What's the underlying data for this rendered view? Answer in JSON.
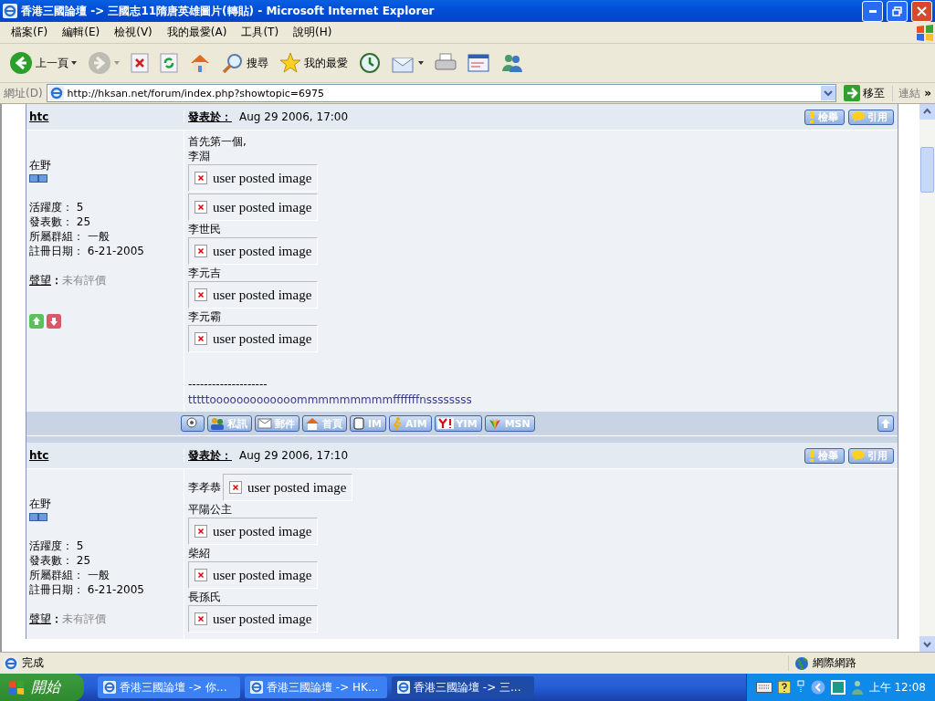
{
  "window": {
    "title": "香港三國論壇 -> 三國志11隋唐英雄圖片(轉貼) - Microsoft Internet Explorer"
  },
  "menu": [
    "檔案(F)",
    "編輯(E)",
    "檢視(V)",
    "我的最愛(A)",
    "工具(T)",
    "說明(H)"
  ],
  "toolbar": [
    {
      "kind": "back",
      "label": "上一頁",
      "dropdown": true,
      "disabled": false
    },
    {
      "kind": "forward",
      "dropdown": true,
      "disabled": true
    },
    {
      "kind": "stop",
      "disabled": false
    },
    {
      "kind": "refresh",
      "disabled": false
    },
    {
      "kind": "home",
      "disabled": false
    },
    {
      "kind": "search",
      "label": "搜尋",
      "disabled": false
    },
    {
      "kind": "favorites",
      "label": "我的最愛",
      "disabled": false
    },
    {
      "kind": "history",
      "disabled": false
    },
    {
      "kind": "mail",
      "dropdown": true,
      "disabled": false
    },
    {
      "kind": "print",
      "disabled": false
    },
    {
      "kind": "edit",
      "disabled": false
    },
    {
      "kind": "messenger",
      "disabled": false
    }
  ],
  "address": {
    "label": "網址(D)",
    "value": "http://hksan.net/forum/index.php?showtopic=6975",
    "go": "移至",
    "links": "連結",
    "more": "»"
  },
  "posts": [
    {
      "author": "htc",
      "rank": "在野",
      "stats": [
        {
          "label": "活躍度：",
          "value": "5"
        },
        {
          "label": "發表數：",
          "value": "25"
        },
        {
          "label": "所屬群組：",
          "value": "一般"
        },
        {
          "label": "註冊日期：",
          "value": "6-21-2005"
        }
      ],
      "reputation_label": "聲望",
      "reputation_sep": "：",
      "reputation_value": "未有評價",
      "posted_label": "發表於：",
      "date": "Aug 29 2006, 17:00",
      "actions": [
        "檢舉",
        "引用"
      ],
      "content": [
        {
          "kind": "text",
          "text": "首先第一個,"
        },
        {
          "kind": "text",
          "text": "李淵"
        },
        {
          "kind": "image",
          "text": "user posted image"
        },
        {
          "kind": "image",
          "text": "user posted image"
        },
        {
          "kind": "text",
          "text": "李世民"
        },
        {
          "kind": "image",
          "text": "user posted image"
        },
        {
          "kind": "text",
          "text": "李元吉"
        },
        {
          "kind": "image",
          "text": "user posted image"
        },
        {
          "kind": "text",
          "text": "李元霸"
        },
        {
          "kind": "image",
          "text": "user posted image"
        }
      ],
      "votes": [
        {
          "kind": "up"
        },
        {
          "kind": "down"
        }
      ],
      "signature_rule": "--------------------",
      "signature": "tttttooooooooooooommmmmmmmmfffffffnssssssss",
      "contacts": [
        {
          "kind": "profile"
        },
        {
          "kind": "pm",
          "label": "私訊"
        },
        {
          "kind": "email",
          "label": "郵件"
        },
        {
          "kind": "home",
          "label": "首頁"
        },
        {
          "kind": "im",
          "label": "IM"
        },
        {
          "kind": "aim",
          "label": "AIM"
        },
        {
          "kind": "yim",
          "label": "YIM"
        },
        {
          "kind": "msn",
          "label": "MSN"
        }
      ]
    },
    {
      "author": "htc",
      "rank": "在野",
      "stats": [
        {
          "label": "活躍度：",
          "value": "5"
        },
        {
          "label": "發表數：",
          "value": "25"
        },
        {
          "label": "所屬群組：",
          "value": "一般"
        },
        {
          "label": "註冊日期：",
          "value": "6-21-2005"
        }
      ],
      "reputation_label": "聲望",
      "reputation_sep": "：",
      "reputation_value": "未有評價",
      "posted_label": "發表於：",
      "date": "Aug 29 2006, 17:10",
      "actions": [
        "檢舉",
        "引用"
      ],
      "content": [
        {
          "kind": "inline",
          "text": "李孝恭",
          "image": "user posted image"
        },
        {
          "kind": "text",
          "text": "平陽公主"
        },
        {
          "kind": "image",
          "text": "user posted image"
        },
        {
          "kind": "text",
          "text": "柴紹"
        },
        {
          "kind": "image",
          "text": "user posted image"
        },
        {
          "kind": "text",
          "text": "長孫氏"
        },
        {
          "kind": "image",
          "text": "user posted image"
        }
      ]
    }
  ],
  "status": {
    "text": "完成",
    "zone": "網際網路"
  },
  "taskbar": {
    "start": "開始",
    "tasks": [
      {
        "label": "香港三國論壇 -> 你...",
        "selected": false
      },
      {
        "label": "香港三國論壇 -> HK...",
        "selected": false
      },
      {
        "label": "香港三國論壇 -> 三...",
        "selected": true
      }
    ],
    "clock": "上午 12:08"
  }
}
